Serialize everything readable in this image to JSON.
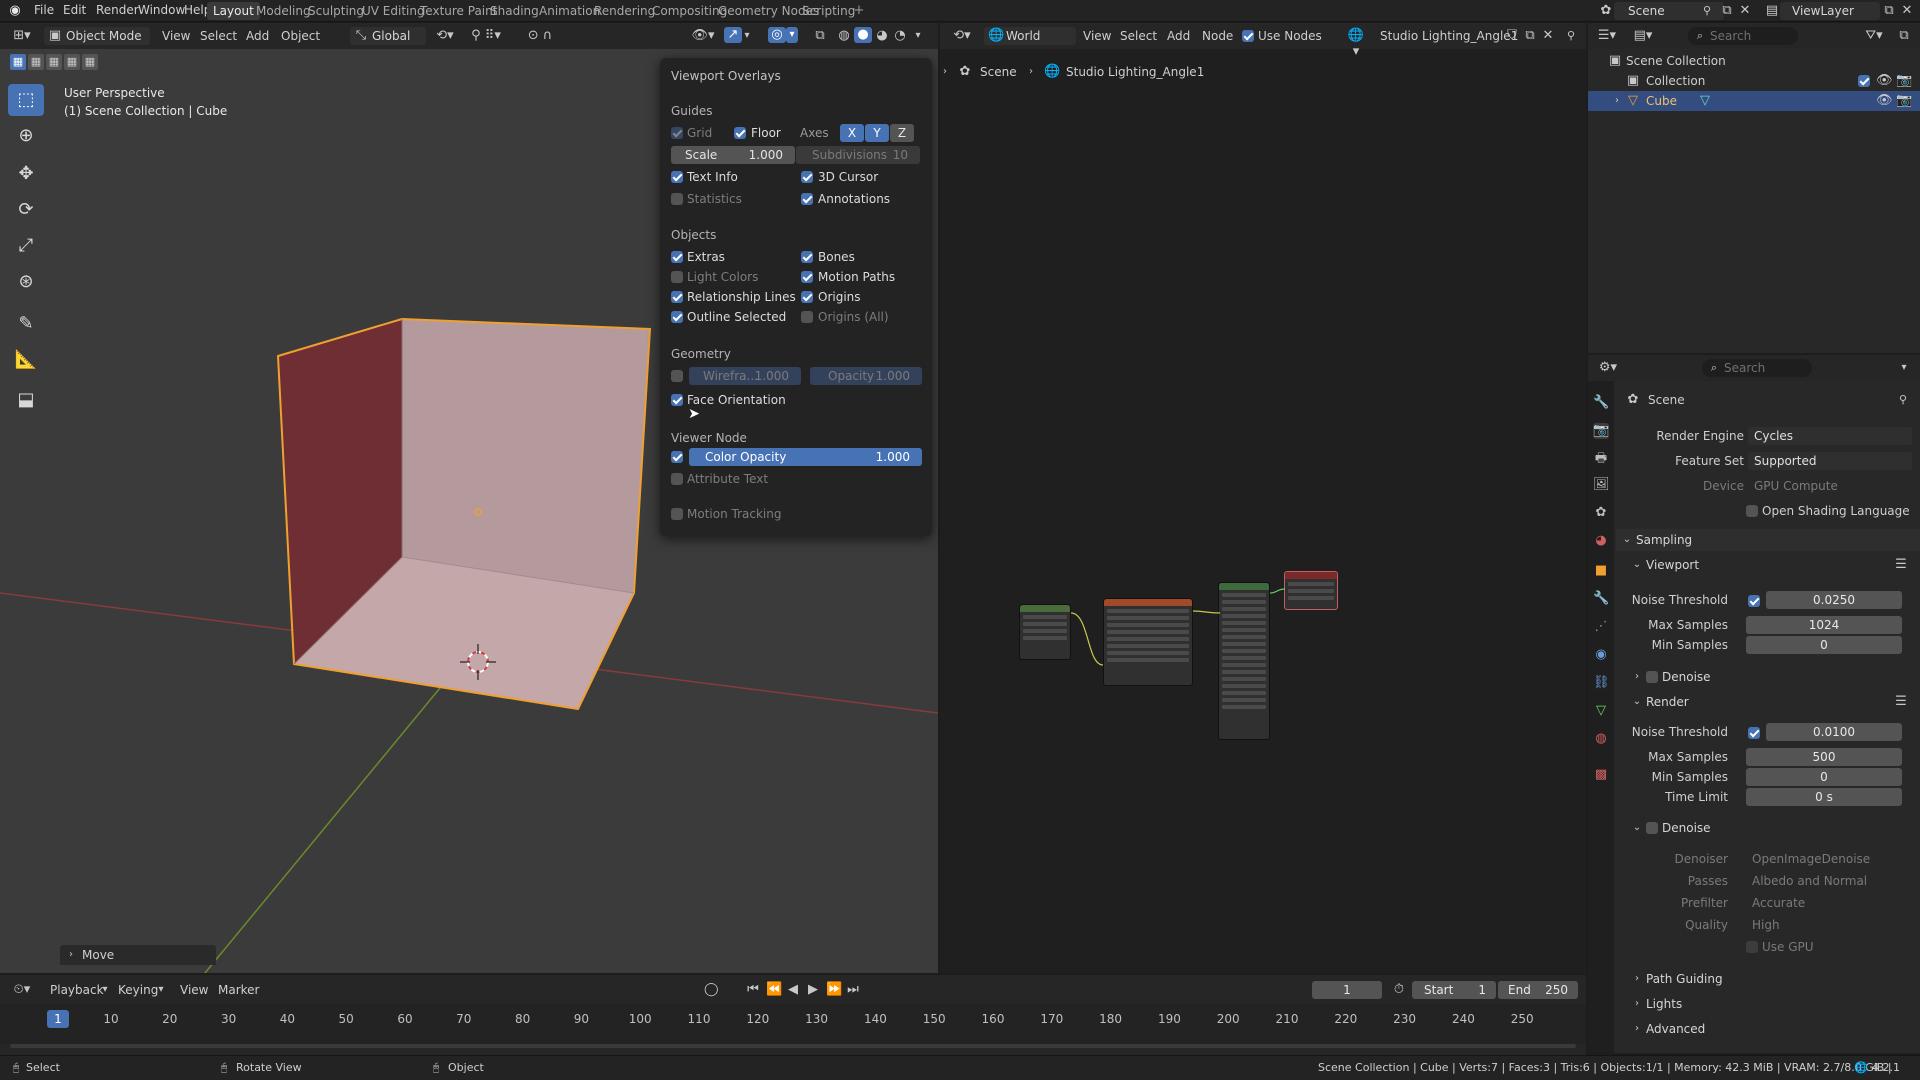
{
  "app": {
    "logo_icon": "blender-icon"
  },
  "menu": [
    "File",
    "Edit",
    "Render",
    "Window",
    "Help"
  ],
  "workspaces": [
    "Layout",
    "Modeling",
    "Sculpting",
    "UV Editing",
    "Texture Paint",
    "Shading",
    "Animation",
    "Rendering",
    "Compositing",
    "Geometry Nodes",
    "Scripting"
  ],
  "active_workspace": "Layout",
  "top_right": {
    "scene": "Scene",
    "view_layer": "ViewLayer"
  },
  "viewport": {
    "mode": "Object Mode",
    "menus": [
      "View",
      "Select",
      "Add",
      "Object"
    ],
    "transform_orientation": "Global",
    "info_line1": "User Perspective",
    "info_line2": "(1) Scene Collection | Cube",
    "last_op": "Move"
  },
  "overlays": {
    "title": "Viewport Overlays",
    "guides_head": "Guides",
    "grid": "Grid",
    "floor": "Floor",
    "axes": "Axes",
    "axis_x": "X",
    "axis_y": "Y",
    "axis_z": "Z",
    "scale_label": "Scale",
    "scale_value": "1.000",
    "subdiv_label": "Subdivisions",
    "subdiv_value": "10",
    "text_info": "Text Info",
    "cursor3d": "3D Cursor",
    "statistics": "Statistics",
    "annotations": "Annotations",
    "objects_head": "Objects",
    "extras": "Extras",
    "bones": "Bones",
    "light_colors": "Light Colors",
    "motion_paths": "Motion Paths",
    "relationship_lines": "Relationship Lines",
    "origins": "Origins",
    "outline_selected": "Outline Selected",
    "origins_all": "Origins (All)",
    "geometry_head": "Geometry",
    "wireframe_label": "Wirefra...",
    "wireframe_value": "1.000",
    "opacity_label": "Opacity",
    "opacity_value": "1.000",
    "face_orientation": "Face Orientation",
    "viewer_head": "Viewer Node",
    "color_opacity_label": "Color Opacity",
    "color_opacity_value": "1.000",
    "attribute_text": "Attribute Text",
    "motion_tracking": "Motion Tracking"
  },
  "node_editor": {
    "world": "World",
    "menus": [
      "View",
      "Select",
      "Add",
      "Node"
    ],
    "use_nodes": "Use Nodes",
    "world_name": "Studio Lighting_Angle1",
    "breadcrumb_scene": "Scene",
    "breadcrumb_world": "Studio Lighting_Angle1"
  },
  "outliner": {
    "search_placeholder": "Search",
    "root": "Scene Collection",
    "collection": "Collection",
    "object": "Cube"
  },
  "properties": {
    "search_placeholder": "Search",
    "context": "Scene",
    "render_engine_label": "Render Engine",
    "render_engine": "Cycles",
    "feature_set_label": "Feature Set",
    "feature_set": "Supported",
    "device_label": "Device",
    "device": "GPU Compute",
    "osl": "Open Shading Language",
    "sampling": "Sampling",
    "viewport": "Viewport",
    "noise_threshold_label": "Noise Threshold",
    "vp_noise": "0.0250",
    "max_samples_label": "Max Samples",
    "vp_max": "1024",
    "min_samples_label": "Min Samples",
    "vp_min": "0",
    "denoise": "Denoise",
    "render": "Render",
    "r_noise": "0.0100",
    "r_max": "500",
    "r_min": "0",
    "time_limit_label": "Time Limit",
    "time_limit": "0 s",
    "denoiser_label": "Denoiser",
    "denoiser": "OpenImageDenoise",
    "passes_label": "Passes",
    "passes": "Albedo and Normal",
    "prefilter_label": "Prefilter",
    "prefilter": "Accurate",
    "quality_label": "Quality",
    "quality": "High",
    "use_gpu": "Use GPU",
    "path_guiding": "Path Guiding",
    "lights": "Lights",
    "advanced": "Advanced"
  },
  "timeline": {
    "menus": [
      "Playback",
      "Keying",
      "View",
      "Marker"
    ],
    "current_frame": "1",
    "start_label": "Start",
    "start": "1",
    "end_label": "End",
    "end": "250",
    "ticks": [
      "1",
      "10",
      "20",
      "30",
      "40",
      "50",
      "60",
      "70",
      "80",
      "90",
      "100",
      "110",
      "120",
      "130",
      "140",
      "150",
      "160",
      "170",
      "180",
      "190",
      "200",
      "210",
      "220",
      "230",
      "240",
      "250"
    ]
  },
  "statusbar": {
    "select": "Select",
    "rotate": "Rotate View",
    "object": "Object",
    "info": "Scene Collection | Cube | Verts:7 | Faces:3 | Tris:6 | Objects:1/1 | Memory: 42.3 MiB | VRAM: 2.7/8.0 GiB |",
    "version": "4.2.1"
  }
}
